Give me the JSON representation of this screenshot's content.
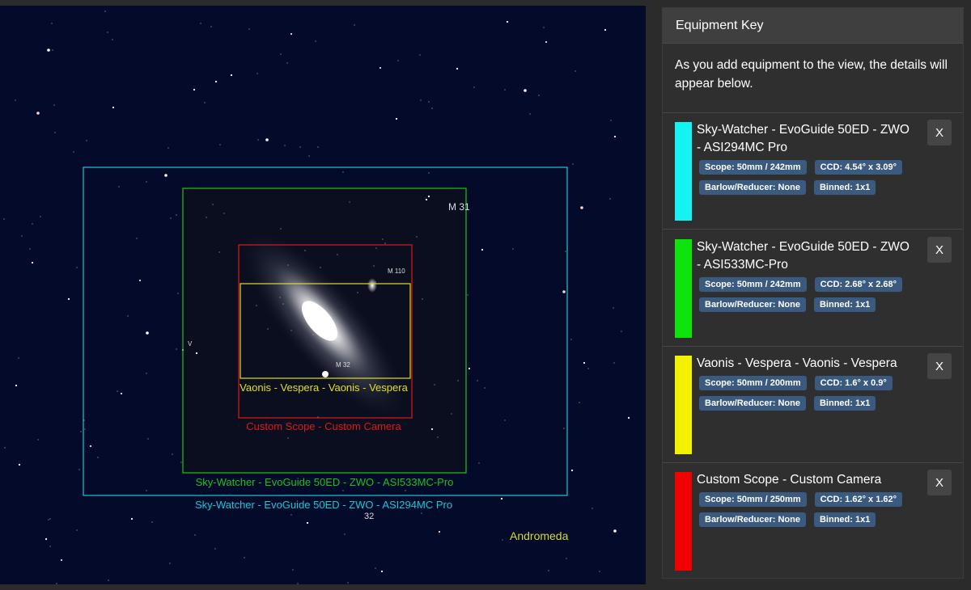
{
  "sky": {
    "fovs": [
      {
        "label": "Sky-Watcher - EvoGuide 50ED - ZWO - ASI294MC Pro",
        "color": "#18c8d8"
      },
      {
        "label": "Sky-Watcher - EvoGuide 50ED - ZWO - ASI533MC-Pro",
        "color": "#1ec21e"
      },
      {
        "label": "Custom Scope - Custom Camera",
        "color": "#e01818"
      },
      {
        "label": "Vaonis - Vespera - Vaonis - Vespera",
        "color": "#e0e018"
      }
    ],
    "labels": {
      "m31": "M 31",
      "m110": "M 110",
      "m32": "M 32",
      "v": "V",
      "star32": "32",
      "constellation": "Andromeda"
    }
  },
  "panel": {
    "title": "Equipment Key",
    "intro": "As you add equipment to the view, the details will appear below.",
    "items": [
      {
        "color": "#14f2f2",
        "title": "Sky-Watcher - EvoGuide 50ED - ZWO - ASI294MC Pro",
        "scope": "Scope: 50mm / 242mm",
        "ccd": "CCD: 4.54° x 3.09°",
        "barlow": "Barlow/Reducer: None",
        "binned": "Binned: 1x1",
        "close": "X"
      },
      {
        "color": "#0ee30e",
        "title": "Sky-Watcher - EvoGuide 50ED - ZWO - ASI533MC-Pro",
        "scope": "Scope: 50mm / 242mm",
        "ccd": "CCD: 2.68° x 2.68°",
        "barlow": "Barlow/Reducer: None",
        "binned": "Binned: 1x1",
        "close": "X"
      },
      {
        "color": "#f2f200",
        "title": "Vaonis - Vespera - Vaonis - Vespera",
        "scope": "Scope: 50mm / 200mm",
        "ccd": "CCD: 1.6° x 0.9°",
        "barlow": "Barlow/Reducer: None",
        "binned": "Binned: 1x1",
        "close": "X"
      },
      {
        "color": "#f20000",
        "title": "Custom Scope - Custom Camera",
        "scope": "Scope: 50mm / 250mm",
        "ccd": "CCD: 1.62° x 1.62°",
        "barlow": "Barlow/Reducer: None",
        "binned": "Binned: 1x1",
        "close": "X"
      }
    ]
  }
}
